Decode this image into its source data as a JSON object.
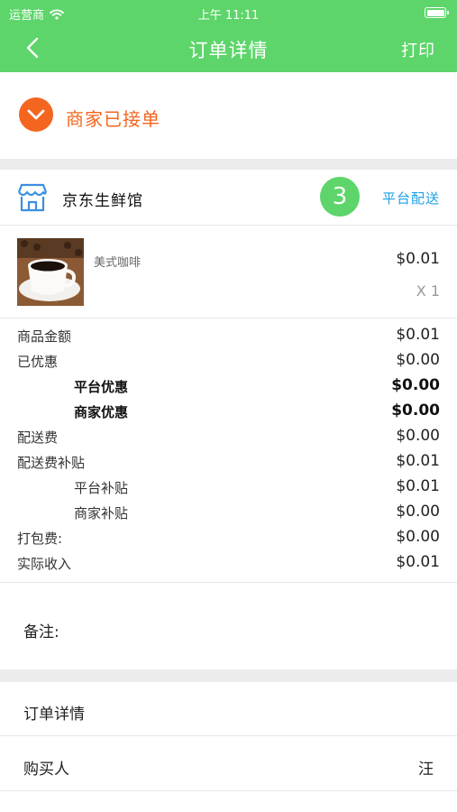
{
  "status_bar": {
    "carrier": "运营商",
    "time": "上午 11:11",
    "wifi_icon": "wifi-icon",
    "battery_icon": "battery-icon"
  },
  "nav": {
    "back_icon": "chevron-left-icon",
    "title": "订单详情",
    "print_label": "打印"
  },
  "order_status": {
    "icon": "check-circle-icon",
    "text": "商家已接单"
  },
  "store": {
    "icon": "store-icon",
    "name": "京东生鲜馆",
    "badge": "3",
    "delivery_type": "平台配送"
  },
  "product": {
    "image": "coffee-cup-image",
    "name": "美式咖啡",
    "price": "$0.01",
    "quantity": "X 1"
  },
  "amounts": [
    {
      "label": "商品金额",
      "value": "$0.01"
    },
    {
      "label": "已优惠",
      "value": "$0.00"
    },
    {
      "label": "平台优惠",
      "value": "$0.00"
    },
    {
      "label": "商家优惠",
      "value": "$0.00"
    },
    {
      "label": "配送费",
      "value": "$0.00"
    },
    {
      "label": "配送费补贴",
      "value": "$0.01"
    },
    {
      "label": "平台补贴",
      "value": "$0.01"
    },
    {
      "label": "商家补贴",
      "value": "$0.00"
    },
    {
      "label": "打包费:",
      "value": "$0.00"
    },
    {
      "label": "实际收入",
      "value": "$0.01"
    }
  ],
  "note": {
    "label": "备注:"
  },
  "order_detail_row": {
    "label": "订单详情"
  },
  "buyer": {
    "label": "购买人",
    "value": "汪"
  },
  "colors": {
    "header_green": "#5dd56a",
    "status_orange": "#f4651f",
    "link_blue": "#1e9fe6",
    "separator_gray": "#ececec"
  }
}
